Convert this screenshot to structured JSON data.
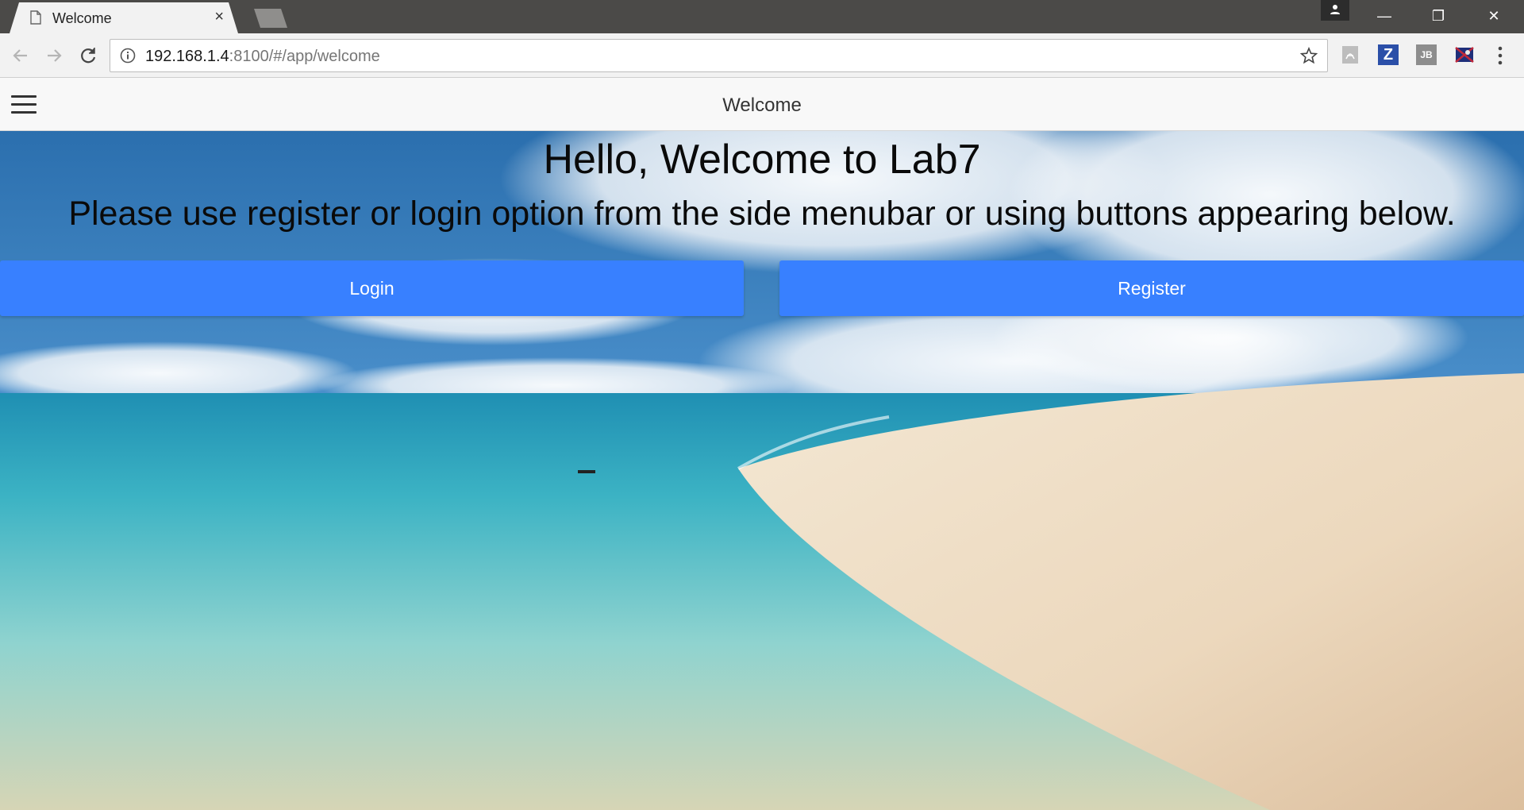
{
  "browser": {
    "tab_title": "Welcome",
    "tab_close": "×",
    "url_host": "192.168.1.4",
    "url_rest": ":8100/#/app/welcome",
    "extensions": {
      "z_label": "Z",
      "jb_label": "JB"
    },
    "window_controls": {
      "minimize": "—",
      "restore": "❐",
      "close": "✕"
    }
  },
  "app": {
    "header_title": "Welcome",
    "headline": "Hello, Welcome to Lab7",
    "subline": "Please use register or login option from the side menubar or using buttons appearing below.",
    "login_label": "Login",
    "register_label": "Register",
    "button_color": "#3880ff"
  }
}
